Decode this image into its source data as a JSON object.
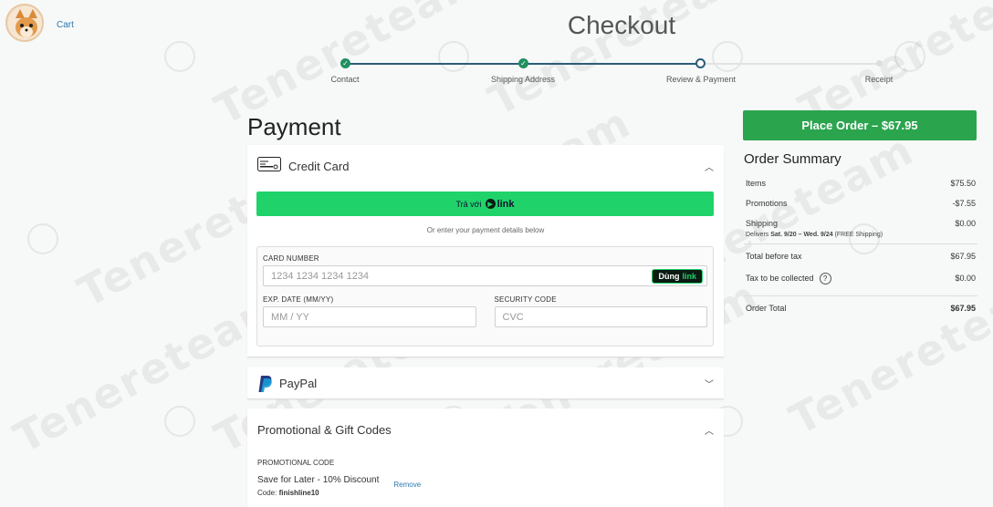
{
  "header": {
    "cart_label": "Cart",
    "title": "Checkout"
  },
  "steps": [
    {
      "label": "Contact",
      "status": "done"
    },
    {
      "label": "Shipping Address",
      "status": "done"
    },
    {
      "label": "Review & Payment",
      "status": "current"
    },
    {
      "label": "Receipt",
      "status": "todo"
    }
  ],
  "payment": {
    "title": "Payment",
    "credit_card": {
      "label": "Credit Card",
      "link_button_prefix": "Trả với",
      "link_button_brand": "link",
      "or_text": "Or enter your payment details below",
      "card_number_label": "CARD NUMBER",
      "card_number_placeholder": "1234 1234 1234 1234",
      "dung_link_prefix": "Dùng",
      "dung_link_brand": "link",
      "exp_label": "EXP. DATE (MM/YY)",
      "exp_placeholder": "MM / YY",
      "cvc_label": "SECURITY CODE",
      "cvc_placeholder": "CVC"
    },
    "paypal": {
      "label": "PayPal"
    },
    "promo": {
      "label": "Promotional & Gift Codes",
      "code_heading": "PROMOTIONAL CODE",
      "promo_name": "Save for Later - 10% Discount",
      "code_prefix": "Code:",
      "code_value": "finishline10",
      "remove_label": "Remove"
    }
  },
  "order": {
    "place_order_label": "Place Order – $67.95",
    "summary_title": "Order Summary",
    "items_label": "Items",
    "items_value": "$75.50",
    "promotions_label": "Promotions",
    "promotions_value": "-$7.55",
    "shipping_label": "Shipping",
    "shipping_value": "$0.00",
    "deliver_prefix": "Delivers",
    "deliver_dates": "Sat. 9/20 – Wed. 9/24",
    "deliver_suffix": "(FREE Shipping)",
    "before_tax_label": "Total before tax",
    "before_tax_value": "$67.95",
    "tax_label": "Tax to be collected",
    "tax_value": "$0.00",
    "total_label": "Order Total",
    "total_value": "$67.95"
  },
  "watermark": {
    "text": "Tenereteam"
  },
  "colors": {
    "accent_green": "#2ba44e",
    "link_green": "#1fd36a",
    "step_done": "#1f8f60",
    "step_line": "#2a5c78"
  }
}
